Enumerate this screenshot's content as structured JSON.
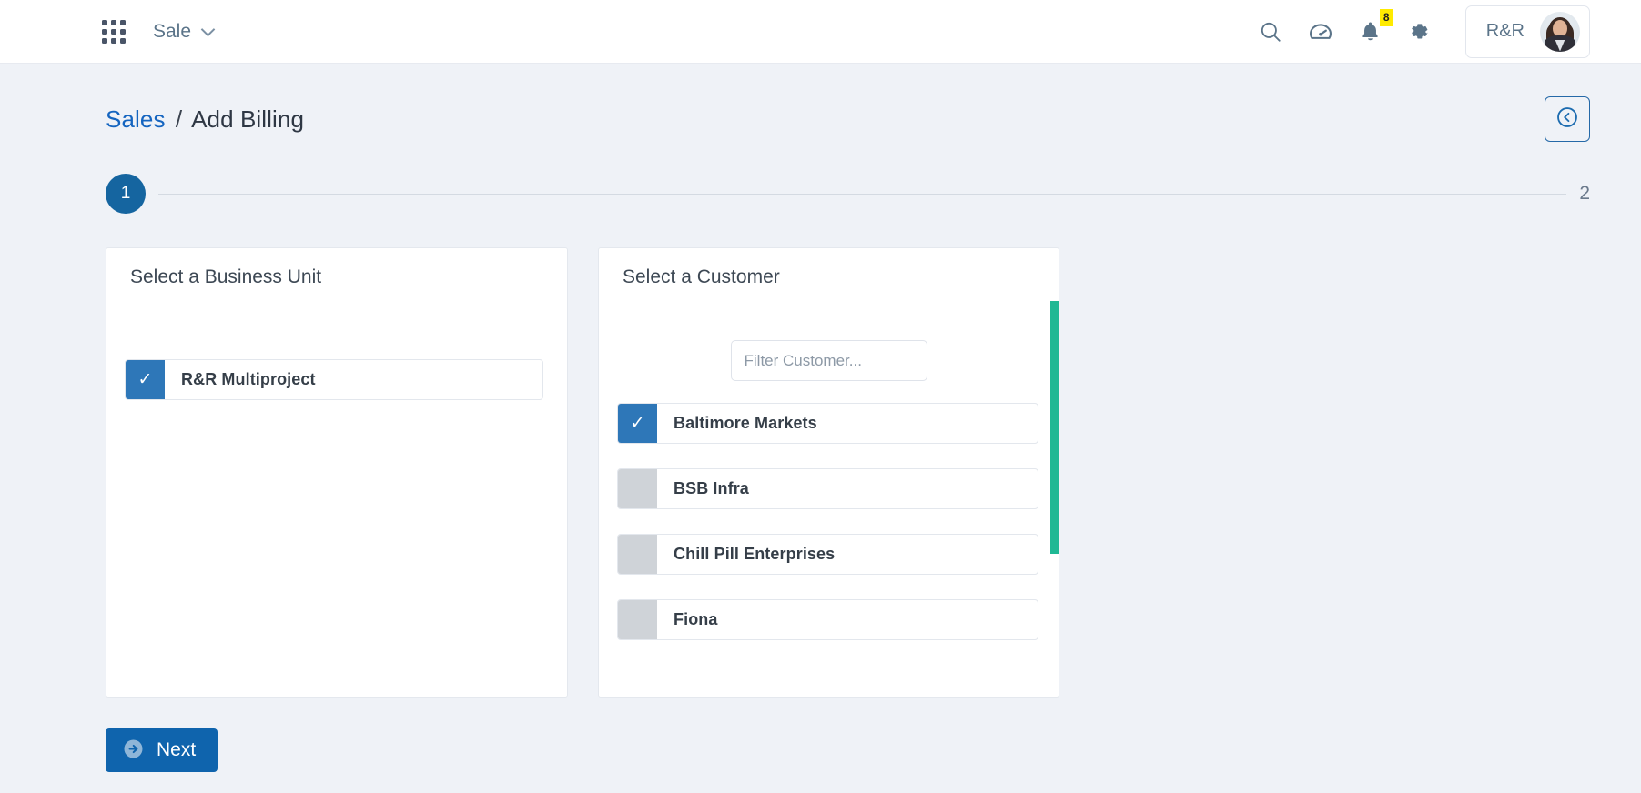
{
  "topbar": {
    "app_launcher_icon": "grid-apps-icon",
    "app_name": "Sale",
    "dropdown_icon": "chevron-down-icon",
    "icons": [
      {
        "name": "search-icon",
        "label": "Search"
      },
      {
        "name": "speedometer-icon",
        "label": "Dashboard"
      },
      {
        "name": "bell-icon",
        "label": "Notifications"
      },
      {
        "name": "gear-icon",
        "label": "Settings"
      }
    ],
    "notification_count": "8",
    "user_name": "R&R",
    "avatar_icon": "user-avatar-photo"
  },
  "breadcrumb": {
    "root": "Sales",
    "separator": "/",
    "current": "Add Billing"
  },
  "back_button": {
    "icon": "circle-chevron-left-icon"
  },
  "stepper": {
    "current_step": "1",
    "next_step": "2"
  },
  "business_unit_panel": {
    "title": "Select a Business Unit",
    "items": [
      {
        "label": "R&R Multiproject",
        "selected": true,
        "check": "✓"
      }
    ]
  },
  "customer_panel": {
    "title": "Select a Customer",
    "filter_placeholder": "Filter Customer...",
    "filter_value": "",
    "items": [
      {
        "label": "Baltimore Markets",
        "selected": true,
        "check": "✓"
      },
      {
        "label": "BSB Infra",
        "selected": false,
        "check": ""
      },
      {
        "label": "Chill Pill Enterprises",
        "selected": false,
        "check": ""
      },
      {
        "label": "Fiona",
        "selected": false,
        "check": ""
      }
    ],
    "scrollbar_color": "#1fb894"
  },
  "footer": {
    "next_label": "Next",
    "next_icon": "circle-arrow-right-icon"
  },
  "colors": {
    "accent_blue": "#0f64ad",
    "link_blue": "#1565c0",
    "checkbox_blue": "#2e77b8",
    "scrollbar_green": "#1fb894",
    "badge_yellow": "#ffeb00",
    "page_bg": "#eff2f7"
  }
}
